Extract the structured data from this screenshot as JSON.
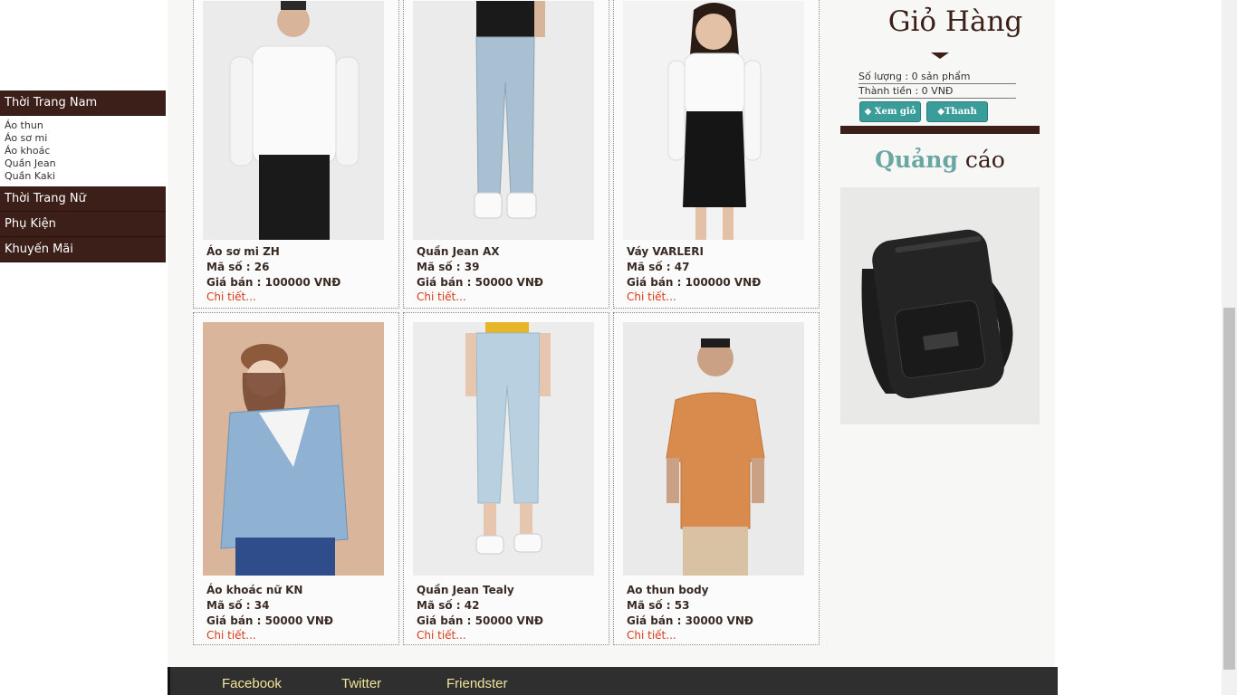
{
  "nav": {
    "men": "Thời Trang Nam",
    "men_items": [
      "Áo thun",
      "Áo sơ mi",
      "Áo khoác",
      "Quần Jean",
      "Quần Kaki"
    ],
    "women": "Thời Trang Nữ",
    "accessories": "Phụ Kiện",
    "promo": "Khuyến Mãi"
  },
  "products": [
    {
      "name": "Áo sơ mi ZH",
      "code": "Mã số : 26",
      "price": "Giá bán : 100000 VNĐ",
      "detail": "Chi tiết..."
    },
    {
      "name": "Quần Jean AX",
      "code": "Mã số : 39",
      "price": "Giá bán : 50000 VNĐ",
      "detail": "Chi tiết..."
    },
    {
      "name": "Váy VARLERI",
      "code": "Mã số : 47",
      "price": "Giá bán : 100000 VNĐ",
      "detail": "Chi tiết..."
    },
    {
      "name": "Áo khoác nữ KN",
      "code": "Mã số : 34",
      "price": "Giá bán : 50000 VNĐ",
      "detail": "Chi tiết..."
    },
    {
      "name": "Quần Jean Tealy",
      "code": "Mã số : 42",
      "price": "Giá bán : 50000 VNĐ",
      "detail": "Chi tiết..."
    },
    {
      "name": "Ao thun body",
      "code": "Mã số : 53",
      "price": "Giá bán : 30000 VNĐ",
      "detail": "Chi tiết..."
    }
  ],
  "cart": {
    "title": "Giỏ Hàng",
    "quantity": "Số lượng : 0 sản phẩm",
    "total": "Thành tiền : 0 VNĐ",
    "view_btn": "Xem giỏ",
    "pay_btn": "Thanh toán"
  },
  "ads": {
    "word1": "Quảng",
    "word2": "cáo"
  },
  "footer": {
    "links": [
      "Facebook",
      "Twitter",
      "Friendster"
    ]
  },
  "colors": {
    "brand": "#3d1f19",
    "accent": "#3b9d9a",
    "link": "#d83a1a",
    "footer_text": "#f2e49b"
  }
}
